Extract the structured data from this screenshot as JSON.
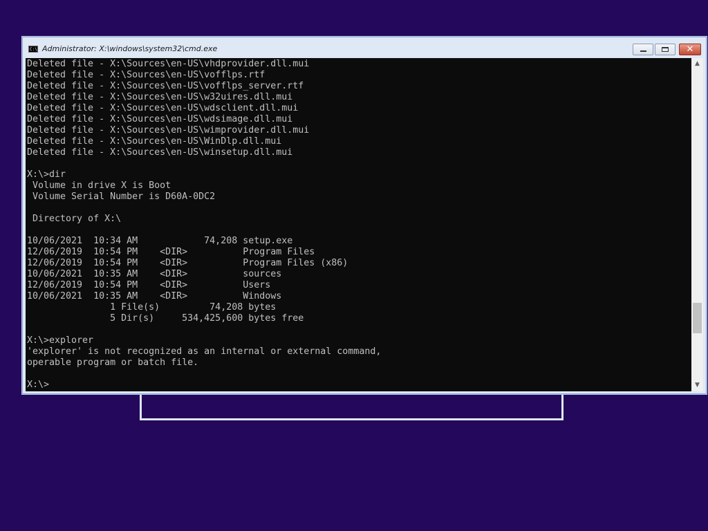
{
  "window": {
    "title": "Administrator: X:\\windows\\system32\\cmd.exe",
    "icon_label": "C:\\",
    "buttons": {
      "minimize": "minimize-icon",
      "maximize": "maximize-icon",
      "close": "close-icon",
      "close_glyph": "✕"
    }
  },
  "console": {
    "lines": [
      "Deleted file - X:\\Sources\\en-US\\vhdprovider.dll.mui",
      "Deleted file - X:\\Sources\\en-US\\vofflps.rtf",
      "Deleted file - X:\\Sources\\en-US\\vofflps_server.rtf",
      "Deleted file - X:\\Sources\\en-US\\w32uires.dll.mui",
      "Deleted file - X:\\Sources\\en-US\\wdsclient.dll.mui",
      "Deleted file - X:\\Sources\\en-US\\wdsimage.dll.mui",
      "Deleted file - X:\\Sources\\en-US\\wimprovider.dll.mui",
      "Deleted file - X:\\Sources\\en-US\\WinDlp.dll.mui",
      "Deleted file - X:\\Sources\\en-US\\winsetup.dll.mui",
      "",
      "X:\\>dir",
      " Volume in drive X is Boot",
      " Volume Serial Number is D60A-0DC2",
      "",
      " Directory of X:\\",
      "",
      "10/06/2021  10:34 AM            74,208 setup.exe",
      "12/06/2019  10:54 PM    <DIR>          Program Files",
      "12/06/2019  10:54 PM    <DIR>          Program Files (x86)",
      "10/06/2021  10:35 AM    <DIR>          sources",
      "12/06/2019  10:54 PM    <DIR>          Users",
      "10/06/2021  10:35 AM    <DIR>          Windows",
      "               1 File(s)         74,208 bytes",
      "               5 Dir(s)     534,425,600 bytes free",
      "",
      "X:\\>explorer",
      "'explorer' is not recognized as an internal or external command,",
      "operable program or batch file.",
      "",
      "X:\\>"
    ]
  },
  "scrollbar": {
    "up_glyph": "▲",
    "down_glyph": "▼"
  },
  "colors": {
    "desktop_background": "#24085c",
    "console_background": "#0c0c0c",
    "console_text": "#c0c0c0",
    "titlebar": "#dfe8f5"
  }
}
